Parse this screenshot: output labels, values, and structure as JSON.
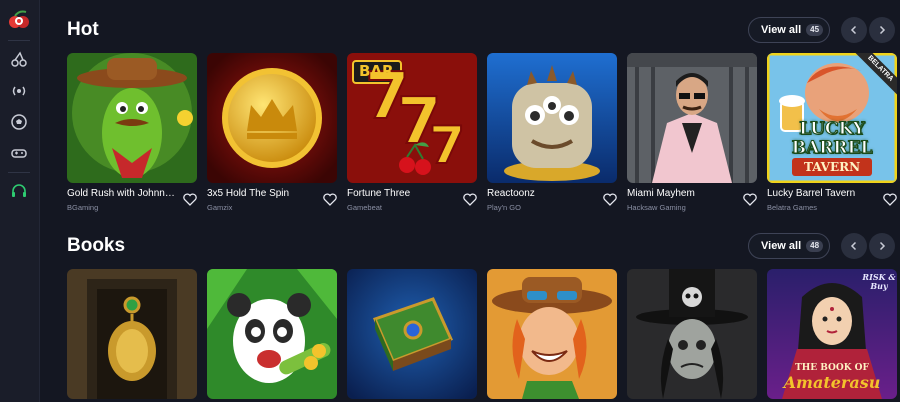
{
  "sidebar": {
    "icons": [
      "cherries-icon",
      "live-broadcast-icon",
      "soccer-ball-icon",
      "gamepad-icon",
      "headset-icon"
    ]
  },
  "sections": [
    {
      "title": "Hot",
      "view_all_label": "View all",
      "view_all_count": "45",
      "games": [
        {
          "title": "Gold Rush with Johnny ...",
          "provider": "BGaming"
        },
        {
          "title": "3x5 Hold The Spin",
          "provider": "Gamzix"
        },
        {
          "title": "Fortune Three",
          "provider": "Gamebeat",
          "art_text": "BAR"
        },
        {
          "title": "Reactoonz",
          "provider": "Play'n GO"
        },
        {
          "title": "Miami Mayhem",
          "provider": "Hacksaw Gaming"
        },
        {
          "title": "Lucky Barrel Tavern",
          "provider": "Belatra Games",
          "art_text_1": "LUCKY",
          "art_text_2": "BARREL",
          "art_text_3": "TAVERN",
          "ribbon": "BELATRA"
        }
      ]
    },
    {
      "title": "Books",
      "view_all_label": "View all",
      "view_all_count": "48",
      "games": [
        {
          "title": ""
        },
        {
          "title": ""
        },
        {
          "title": ""
        },
        {
          "title": ""
        },
        {
          "title": ""
        },
        {
          "title": "",
          "art_text_1": "THE BOOK OF",
          "art_text_2": "Amaterasu",
          "art_badge": "RISK & Buy"
        }
      ]
    }
  ],
  "colors": {
    "background": "#141722",
    "sidebar": "#1a1d29",
    "muted_text": "#8a8fa3",
    "accent_green": "#2ecc71"
  }
}
